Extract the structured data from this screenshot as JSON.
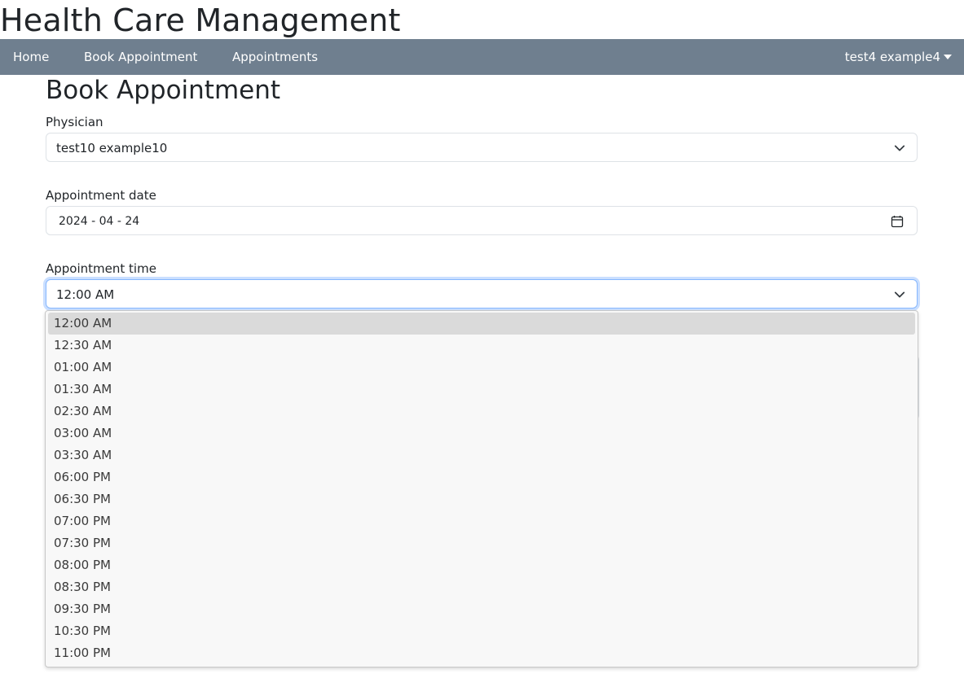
{
  "app": {
    "title": "Health Care Management"
  },
  "nav": {
    "items": [
      {
        "label": "Home"
      },
      {
        "label": "Book Appointment"
      },
      {
        "label": "Appointments"
      }
    ],
    "user": "test4 example4"
  },
  "page": {
    "heading": "Book Appointment"
  },
  "form": {
    "physician": {
      "label": "Physician",
      "value": "test10 example10"
    },
    "date": {
      "label": "Appointment date",
      "value": "2024 - 04 - 24"
    },
    "time": {
      "label": "Appointment time",
      "value": "12:00 AM",
      "options": [
        "12:00 AM",
        "12:30 AM",
        "01:00 AM",
        "01:30 AM",
        "02:30 AM",
        "03:00 AM",
        "03:30 AM",
        "06:00 PM",
        "06:30 PM",
        "07:00 PM",
        "07:30 PM",
        "08:00 PM",
        "08:30 PM",
        "09:30 PM",
        "10:30 PM",
        "11:00 PM"
      ]
    }
  },
  "colors": {
    "navbar": "#6f7f8f",
    "focus_border": "#86b7fe",
    "selected_option": "#dadada"
  },
  "icons": {
    "select_chevron": "chevron-down-icon",
    "date_picker": "calendar-icon",
    "user_menu": "caret-down-icon"
  }
}
